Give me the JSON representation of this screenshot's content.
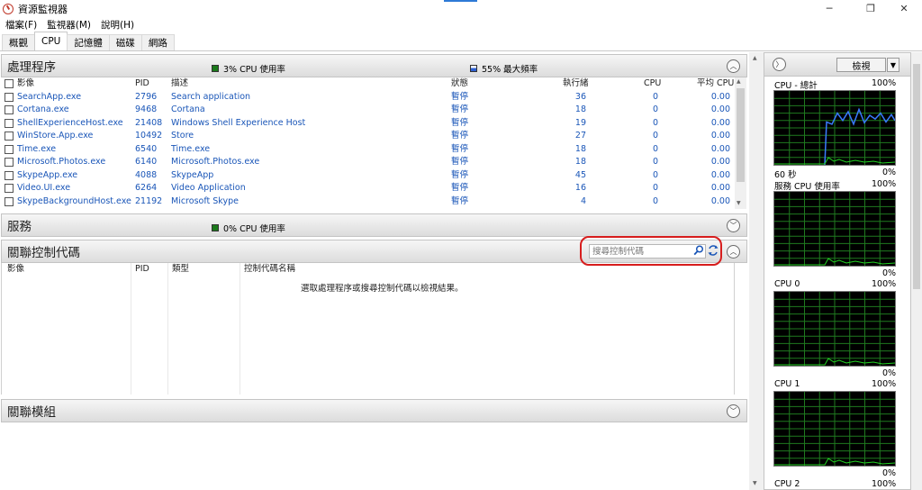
{
  "window": {
    "title": "資源監視器",
    "minimize": "─",
    "maximize": "❐",
    "close": "✕"
  },
  "menu": [
    "檔案(F)",
    "監視器(M)",
    "說明(H)"
  ],
  "tabs": [
    "概觀",
    "CPU",
    "記憶體",
    "磁碟",
    "網路"
  ],
  "processes": {
    "title": "處理程序",
    "cpu_usage": "3% CPU 使用率",
    "max_freq": "55% 最大頻率",
    "columns": {
      "image": "影像",
      "pid": "PID",
      "desc": "描述",
      "status": "狀態",
      "threads": "執行緒",
      "cpu": "CPU",
      "avg_cpu": "平均 CPU"
    },
    "rows": [
      {
        "image": "SearchApp.exe",
        "pid": "2796",
        "desc": "Search application",
        "status": "暫停",
        "threads": "36",
        "cpu": "0",
        "avg": "0.00"
      },
      {
        "image": "Cortana.exe",
        "pid": "9468",
        "desc": "Cortana",
        "status": "暫停",
        "threads": "18",
        "cpu": "0",
        "avg": "0.00"
      },
      {
        "image": "ShellExperienceHost.exe",
        "pid": "21408",
        "desc": "Windows Shell Experience Host",
        "status": "暫停",
        "threads": "19",
        "cpu": "0",
        "avg": "0.00"
      },
      {
        "image": "WinStore.App.exe",
        "pid": "10492",
        "desc": "Store",
        "status": "暫停",
        "threads": "27",
        "cpu": "0",
        "avg": "0.00"
      },
      {
        "image": "Time.exe",
        "pid": "6540",
        "desc": "Time.exe",
        "status": "暫停",
        "threads": "18",
        "cpu": "0",
        "avg": "0.00"
      },
      {
        "image": "Microsoft.Photos.exe",
        "pid": "6140",
        "desc": "Microsoft.Photos.exe",
        "status": "暫停",
        "threads": "18",
        "cpu": "0",
        "avg": "0.00"
      },
      {
        "image": "SkypeApp.exe",
        "pid": "4088",
        "desc": "SkypeApp",
        "status": "暫停",
        "threads": "45",
        "cpu": "0",
        "avg": "0.00"
      },
      {
        "image": "Video.UI.exe",
        "pid": "6264",
        "desc": "Video Application",
        "status": "暫停",
        "threads": "16",
        "cpu": "0",
        "avg": "0.00"
      },
      {
        "image": "SkypeBackgroundHost.exe",
        "pid": "21192",
        "desc": "Microsoft Skype",
        "status": "暫停",
        "threads": "4",
        "cpu": "0",
        "avg": "0.00"
      }
    ]
  },
  "services": {
    "title": "服務",
    "cpu_usage": "0% CPU 使用率"
  },
  "handles": {
    "title": "關聯控制代碼",
    "search_placeholder": "搜尋控制代碼",
    "columns": {
      "image": "影像",
      "pid": "PID",
      "type": "類型",
      "name": "控制代碼名稱"
    },
    "hint": "選取處理程序或搜尋控制代碼以檢視結果。"
  },
  "modules": {
    "title": "關聯模組"
  },
  "right_panel": {
    "view_label": "檢視",
    "graphs": [
      {
        "label": "CPU - 總計",
        "max": "100%",
        "min_left": "60 秒",
        "min": "0%"
      },
      {
        "label": "服務 CPU 使用率",
        "max": "100%",
        "min": "0%"
      },
      {
        "label": "CPU 0",
        "max": "100%",
        "min": "0%"
      },
      {
        "label": "CPU 1",
        "max": "100%",
        "min": "0%"
      },
      {
        "label": "CPU 2",
        "max": "100%"
      }
    ]
  },
  "colors": {
    "link": "#1a56b8",
    "highlight": "#d71d1d",
    "graph_bg": "#000000",
    "graph_grid": "#1f7a1f",
    "cpu_line": "#3a7bff",
    "usage_line": "#22d022"
  }
}
